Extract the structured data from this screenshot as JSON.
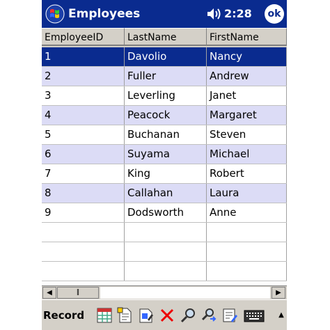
{
  "titlebar": {
    "title": "Employees",
    "clock": "2:28",
    "ok_label": "ok"
  },
  "grid": {
    "columns": [
      "EmployeeID",
      "LastName",
      "FirstName"
    ],
    "rows": [
      [
        "1",
        "Davolio",
        "Nancy"
      ],
      [
        "2",
        "Fuller",
        "Andrew"
      ],
      [
        "3",
        "Leverling",
        "Janet"
      ],
      [
        "4",
        "Peacock",
        "Margaret"
      ],
      [
        "5",
        "Buchanan",
        "Steven"
      ],
      [
        "6",
        "Suyama",
        "Michael"
      ],
      [
        "7",
        "King",
        "Robert"
      ],
      [
        "8",
        "Callahan",
        "Laura"
      ],
      [
        "9",
        "Dodsworth",
        "Anne"
      ],
      [
        "",
        "",
        ""
      ],
      [
        "",
        "",
        ""
      ],
      [
        "",
        "",
        ""
      ]
    ],
    "selected_row": 0
  },
  "toolbar": {
    "menu_label": "Record",
    "icons": [
      "grid-view-icon",
      "new-record-icon",
      "edit-record-icon",
      "delete-icon",
      "find-icon",
      "find-next-icon",
      "notes-icon",
      "keyboard-icon"
    ]
  },
  "colors": {
    "titlebar": "#0a2b8f",
    "alt_row": "#dcdcf6",
    "selection": "#0a2b8f",
    "chrome": "#d4d0c8"
  }
}
